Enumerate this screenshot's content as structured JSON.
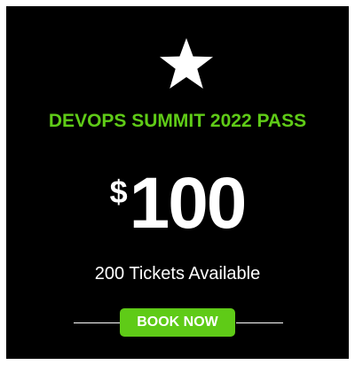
{
  "card": {
    "icon": "star-icon",
    "title": "DEVOPS SUMMIT 2022 PASS",
    "price_currency": "$",
    "price_amount": "100",
    "availability": "200 Tickets Available",
    "cta_label": "BOOK NOW"
  },
  "colors": {
    "background": "#000000",
    "accent": "#5fcb17",
    "text": "#ffffff"
  }
}
